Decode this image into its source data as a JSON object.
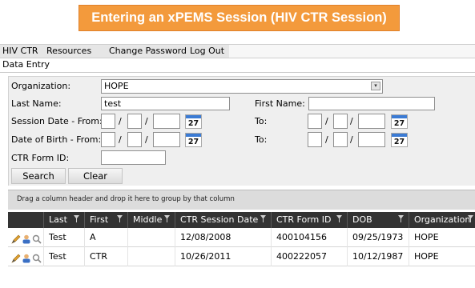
{
  "banner": {
    "title": "Entering an xPEMS Session (HIV CTR Session)"
  },
  "menu": {
    "items": [
      "HIV CTR",
      "Resources",
      "Change Password",
      "Log Out"
    ]
  },
  "breadcrumb": "Data Entry",
  "form": {
    "organization_label": "Organization:",
    "organization_value": "HOPE",
    "last_name_label": "Last Name:",
    "last_name_value": "test",
    "first_name_label": "First Name:",
    "first_name_value": "",
    "session_date_from_label": "Session Date - From:",
    "to_label": "To:",
    "dob_from_label": "Date of Birth - From:",
    "ctr_form_id_label": "CTR Form ID:",
    "calendar_day": "27",
    "date_separator": "/",
    "search_label": "Search",
    "clear_label": "Clear"
  },
  "grid": {
    "group_hint": "Drag a column header and drop it here to group by that column",
    "columns": [
      "Last",
      "First",
      "Middle",
      "CTR Session Date",
      "CTR Form ID",
      "DOB",
      "Organization"
    ],
    "rows": [
      {
        "last": "Test",
        "first": "A",
        "middle": "",
        "session_date": "12/08/2008",
        "form_id": "400104156",
        "dob": "09/25/1973",
        "organization": "HOPE"
      },
      {
        "last": "Test",
        "first": "CTR",
        "middle": "",
        "session_date": "10/26/2011",
        "form_id": "400222057",
        "dob": "10/12/1987",
        "organization": "HOPE"
      }
    ]
  },
  "colors": {
    "banner": "#f39a3c",
    "header": "#333333",
    "calendar_accent": "#3b7bd4"
  },
  "icons": [
    "filter-icon",
    "edit-pencil-icon",
    "user-icon",
    "view-magnifier-icon",
    "calendar-icon",
    "dropdown-arrow-icon"
  ]
}
